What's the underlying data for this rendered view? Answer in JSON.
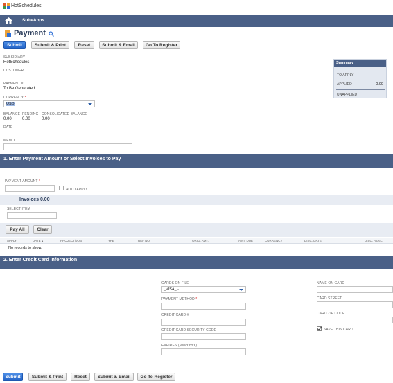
{
  "app": {
    "name": "HotSchedules",
    "nav_item": "SuiteApps"
  },
  "page": {
    "title": "Payment"
  },
  "buttons": {
    "submit": "Submit",
    "submit_print": "Submit & Print",
    "reset": "Reset",
    "submit_email": "Submit & Email",
    "go_to_register": "Go To Register"
  },
  "fields": {
    "subsidiary_label": "SUBSIDIARY",
    "subsidiary_value": "HotSchedules",
    "customer_label": "CUSTOMER",
    "payment_no_label": "PAYMENT #",
    "payment_no_value": "To Be Generated",
    "currency_label": "CURRENCY",
    "currency_value": "USD",
    "required_mark": "*",
    "balance_label": "BALANCE",
    "balance_value": "0.00",
    "pending_label": "PENDING",
    "pending_value": "0.00",
    "consolidated_label": "CONSOLIDATED BALANCE",
    "consolidated_value": "0.00",
    "date_label": "DATE",
    "memo_label": "MEMO"
  },
  "summary": {
    "title": "Summary",
    "to_apply": "TO APPLY",
    "applied": "APPLIED",
    "applied_value": "0.00",
    "unapplied": "UNAPPLIED"
  },
  "section1": {
    "title": "1. Enter Payment Amount or Select Invoices to Pay",
    "payment_amount_label": "PAYMENT AMOUNT",
    "auto_apply_label": "AUTO APPLY",
    "invoices_tab": "Invoices 0.00",
    "select_item_label": "SELECT ITEM",
    "pay_all": "Pay All",
    "clear": "Clear",
    "columns": [
      "APPLY",
      "DATE ▴",
      "PROJECT/JOB",
      "TYPE",
      "REF NO.",
      "ORIG. AMT.",
      "AMT. DUE",
      "CURRENCY",
      "DISC. DATE",
      "DISC. AVAIL."
    ],
    "empty": "No records to show."
  },
  "section2": {
    "title": "2. Enter Credit Card Information",
    "cards_on_file_label": "CARDS ON FILE",
    "cards_on_file_value": "_VISA_ -",
    "payment_method_label": "PAYMENT METHOD",
    "credit_card_no_label": "CREDIT CARD #",
    "security_code_label": "CREDIT CARD SECURITY CODE",
    "expires_label": "EXPIRES (MM/YYYY)",
    "name_on_card_label": "NAME ON CARD",
    "card_street_label": "CARD STREET",
    "card_zip_label": "CARD ZIP CODE",
    "save_card_label": "SAVE THIS CARD"
  },
  "colors": {
    "nav": "#4a6087",
    "primary": "#2f6fd6",
    "band": "#e8ecf3"
  }
}
